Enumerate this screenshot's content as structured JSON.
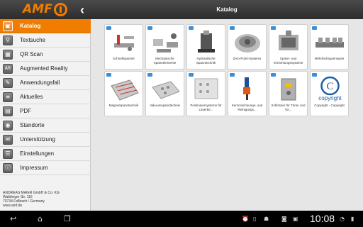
{
  "header": {
    "logo_text": "AMF",
    "back_icon": "chevron-left-icon",
    "title": "Katalog"
  },
  "sidebar": {
    "items": [
      {
        "label": "Katalog",
        "icon": "book-icon",
        "glyph": "▣",
        "active": true
      },
      {
        "label": "Textsuche",
        "icon": "search-icon",
        "glyph": "⚲",
        "active": false
      },
      {
        "label": "QR Scan",
        "icon": "qr-icon",
        "glyph": "▦",
        "active": false
      },
      {
        "label": "Augmented Reality",
        "icon": "ar-icon",
        "glyph": "AR",
        "active": false
      },
      {
        "label": "Anwendungsfall",
        "icon": "usecase-icon",
        "glyph": "✎",
        "active": false
      },
      {
        "label": "Aktuelles",
        "icon": "news-icon",
        "glyph": "≡",
        "active": false
      },
      {
        "label": "PDF",
        "icon": "pdf-icon",
        "glyph": "▤",
        "active": false
      },
      {
        "label": "Standorte",
        "icon": "location-icon",
        "glyph": "◉",
        "active": false
      },
      {
        "label": "Unterstützung",
        "icon": "support-icon",
        "glyph": "✉",
        "active": false
      },
      {
        "label": "Einstellungen",
        "icon": "settings-icon",
        "glyph": "☰",
        "active": false
      },
      {
        "label": "Impressum",
        "icon": "info-icon",
        "glyph": "ⓘ",
        "active": false
      }
    ],
    "address": [
      "ANDREAS MAIER GmbH & Co. KG",
      "Waiblinger Str. 116",
      "70734 Fellbach / Germany",
      "www.amf.de"
    ]
  },
  "catalog": {
    "tiles": [
      {
        "label": "Schnellspanner",
        "icon": "toggle-clamp-icon"
      },
      {
        "label": "Mechanische Spannelemente",
        "icon": "mechanical-clamp-icon"
      },
      {
        "label": "Hydraulische Spanntechnik",
        "icon": "hydraulic-clamp-icon"
      },
      {
        "label": "Zero-Point-Systems",
        "icon": "zero-point-icon"
      },
      {
        "label": "Spann- und Vorrichtungssysteme",
        "icon": "fixture-system-icon"
      },
      {
        "label": "Mehrfachspannsyste",
        "icon": "multi-clamp-icon"
      },
      {
        "label": "Magnetspanntechnik",
        "icon": "magnet-plate-icon"
      },
      {
        "label": "Vakuumspanntechnik",
        "icon": "vacuum-plate-icon"
      },
      {
        "label": "Positioniersysteme für Laserbe...",
        "icon": "laser-positioning-icon"
      },
      {
        "label": "Kennzeichnungs- und Reinigungs...",
        "icon": "marking-tool-icon"
      },
      {
        "label": "Schlösser für Türen und Tor...",
        "icon": "door-lock-icon"
      },
      {
        "label": "Copyright - Copyright",
        "icon": "copyright-icon",
        "text": "copyright"
      }
    ]
  },
  "navbar": {
    "back_icon": "nav-back-icon",
    "home_icon": "nav-home-icon",
    "recent_icon": "nav-recent-apps-icon",
    "time": "10:08"
  },
  "colors": {
    "accent": "#f07d00",
    "badge": "#3a8fd8"
  }
}
